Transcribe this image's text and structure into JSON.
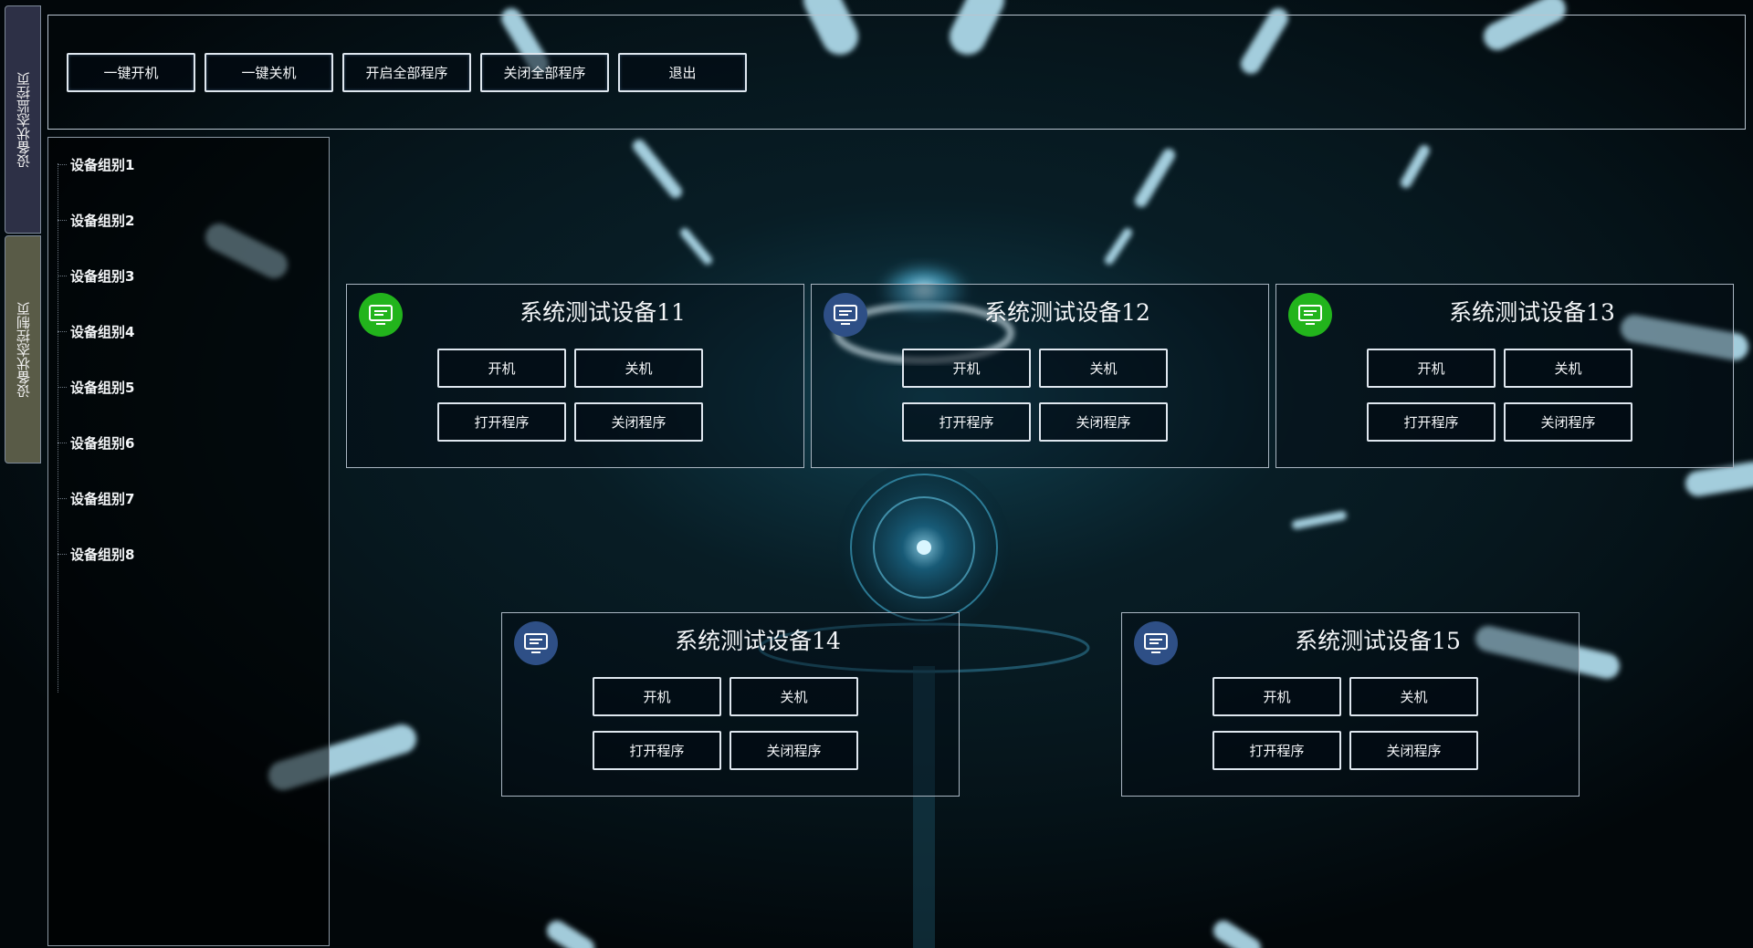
{
  "tabs": {
    "monitor_label": "设备状态监控页",
    "control_label": "设备状态控制页"
  },
  "toolbar": {
    "buttons": [
      "一键开机",
      "一键关机",
      "开启全部程序",
      "关闭全部程序",
      "退出"
    ]
  },
  "groups": [
    "设备组别1",
    "设备组别2",
    "设备组别3",
    "设备组别4",
    "设备组别5",
    "设备组别6",
    "设备组别7",
    "设备组别8"
  ],
  "devices": [
    {
      "name": "系统测试设备11",
      "status": "online",
      "icon": "monitor-icon",
      "buttons": [
        "开机",
        "关机",
        "打开程序",
        "关闭程序"
      ]
    },
    {
      "name": "系统测试设备12",
      "status": "offline",
      "icon": "monitor-icon",
      "buttons": [
        "开机",
        "关机",
        "打开程序",
        "关闭程序"
      ]
    },
    {
      "name": "系统测试设备13",
      "status": "online",
      "icon": "monitor-icon",
      "buttons": [
        "开机",
        "关机",
        "打开程序",
        "关闭程序"
      ]
    },
    {
      "name": "系统测试设备14",
      "status": "offline",
      "icon": "monitor-icon",
      "buttons": [
        "开机",
        "关机",
        "打开程序",
        "关闭程序"
      ]
    },
    {
      "name": "系统测试设备15",
      "status": "offline",
      "icon": "monitor-icon",
      "buttons": [
        "开机",
        "关机",
        "打开程序",
        "关闭程序"
      ]
    }
  ],
  "colors": {
    "online": "#22b41c",
    "offline": "#2e4f86",
    "tab_monitor": "#2d3046",
    "tab_control": "#595b47"
  }
}
